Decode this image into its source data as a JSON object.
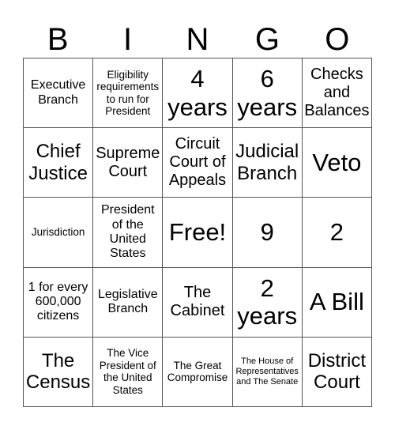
{
  "header": [
    "B",
    "I",
    "N",
    "G",
    "O"
  ],
  "cells": [
    {
      "text": "Executive Branch",
      "size": "md"
    },
    {
      "text": "Eligibility requirements to run for President",
      "size": "sm"
    },
    {
      "text": "4 years",
      "size": "xxl"
    },
    {
      "text": "6 years",
      "size": "xxl"
    },
    {
      "text": "Checks and Balances",
      "size": "lg"
    },
    {
      "text": "Chief Justice",
      "size": "xl"
    },
    {
      "text": "Supreme Court",
      "size": "lg"
    },
    {
      "text": "Circuit Court of Appeals",
      "size": "lg"
    },
    {
      "text": "Judicial Branch",
      "size": "xl"
    },
    {
      "text": "Veto",
      "size": "xxl"
    },
    {
      "text": "Jurisdiction",
      "size": "sm"
    },
    {
      "text": "President of the United States",
      "size": "md"
    },
    {
      "text": "Free!",
      "size": "xxl"
    },
    {
      "text": "9",
      "size": "xxl"
    },
    {
      "text": "2",
      "size": "xxl"
    },
    {
      "text": "1 for every 600,000 citizens",
      "size": "md"
    },
    {
      "text": "Legislative Branch",
      "size": "md"
    },
    {
      "text": "The Cabinet",
      "size": "lg"
    },
    {
      "text": "2 years",
      "size": "xxl"
    },
    {
      "text": "A Bill",
      "size": "xxl"
    },
    {
      "text": "The Census",
      "size": "xl"
    },
    {
      "text": "The Vice President of the United States",
      "size": "sm"
    },
    {
      "text": "The Great Compromise",
      "size": "sm"
    },
    {
      "text": "The House of Representatives and The Senate",
      "size": "xs"
    },
    {
      "text": "District Court",
      "size": "xl"
    }
  ]
}
